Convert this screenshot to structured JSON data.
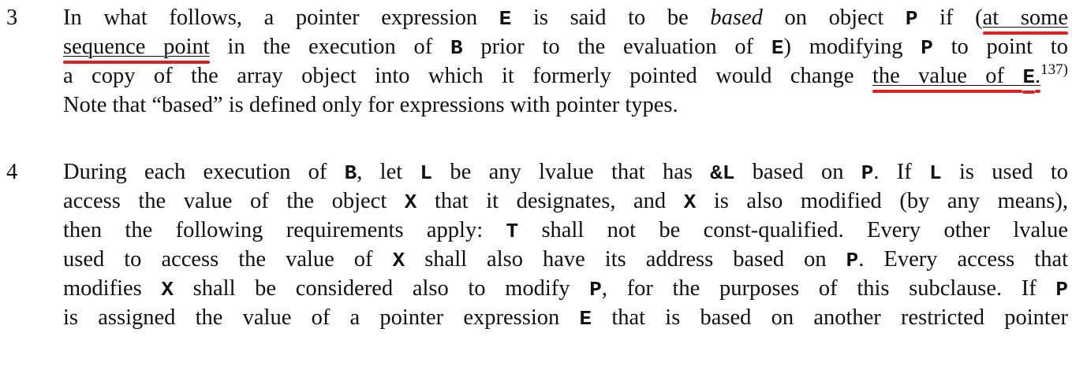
{
  "paragraphs": [
    {
      "number": "3",
      "lines": [
        {
          "segments": [
            {
              "t": "In what follows, a pointer expression "
            },
            {
              "t": "E",
              "s": "code"
            },
            {
              "t": " is said to be "
            },
            {
              "t": "based",
              "s": "em"
            },
            {
              "t": " on object "
            },
            {
              "t": "P",
              "s": "code"
            },
            {
              "t": " if ("
            },
            {
              "t": "at some",
              "s": "ul"
            }
          ]
        },
        {
          "segments": [
            {
              "t": "sequence point",
              "s": "ul"
            },
            {
              "t": " in the execution of "
            },
            {
              "t": "B",
              "s": "code"
            },
            {
              "t": " prior to the evaluation of "
            },
            {
              "t": "E",
              "s": "code"
            },
            {
              "t": ") modifying "
            },
            {
              "t": "P",
              "s": "code"
            },
            {
              "t": " to point to"
            }
          ]
        },
        {
          "segments": [
            {
              "t": "a copy of the array object into which it formerly pointed would change "
            },
            {
              "t": "the value of ",
              "s": "ul"
            },
            {
              "t": "E",
              "s": "ulcode"
            },
            {
              "t": ".",
              "s": "ul"
            },
            {
              "t": "137)",
              "s": "sup"
            }
          ]
        },
        {
          "last": true,
          "segments": [
            {
              "t": "Note that “based” is defined only for expressions with pointer types."
            }
          ]
        }
      ]
    },
    {
      "number": "4",
      "lines": [
        {
          "segments": [
            {
              "t": "During each execution of "
            },
            {
              "t": "B",
              "s": "code"
            },
            {
              "t": ", let "
            },
            {
              "t": "L",
              "s": "code"
            },
            {
              "t": " be any lvalue that has "
            },
            {
              "t": "&L",
              "s": "code"
            },
            {
              "t": " based on "
            },
            {
              "t": "P",
              "s": "code"
            },
            {
              "t": ". If "
            },
            {
              "t": "L",
              "s": "code"
            },
            {
              "t": " is used to"
            }
          ]
        },
        {
          "segments": [
            {
              "t": "access the value of the object "
            },
            {
              "t": "X",
              "s": "code"
            },
            {
              "t": " that it designates, and "
            },
            {
              "t": "X",
              "s": "code"
            },
            {
              "t": " is also modified (by any means),"
            }
          ]
        },
        {
          "segments": [
            {
              "t": "then the following requirements apply: "
            },
            {
              "t": "T",
              "s": "code"
            },
            {
              "t": " shall not be const-qualified.  Every other lvalue"
            }
          ]
        },
        {
          "segments": [
            {
              "t": "used to access the value of "
            },
            {
              "t": "X",
              "s": "code"
            },
            {
              "t": " shall also have its address based on "
            },
            {
              "t": "P",
              "s": "code"
            },
            {
              "t": ". Every access that"
            }
          ]
        },
        {
          "segments": [
            {
              "t": "modifies "
            },
            {
              "t": "X",
              "s": "code"
            },
            {
              "t": " shall be considered also to modify "
            },
            {
              "t": "P",
              "s": "code"
            },
            {
              "t": ", for the purposes of this subclause.  If "
            },
            {
              "t": "P",
              "s": "code"
            }
          ]
        },
        {
          "segments": [
            {
              "t": "is assigned the value of a pointer expression "
            },
            {
              "t": "E",
              "s": "code"
            },
            {
              "t": " that is based on another restricted pointer"
            }
          ]
        }
      ]
    }
  ]
}
